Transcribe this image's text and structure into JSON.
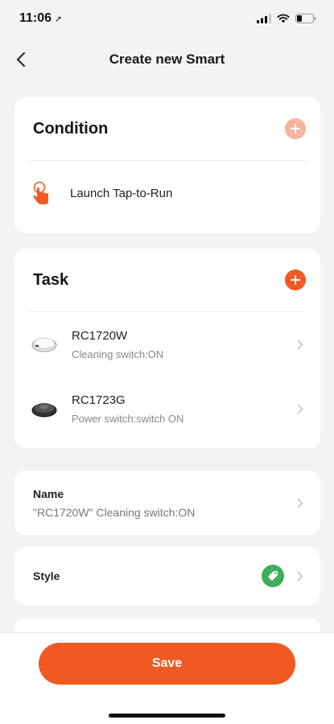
{
  "status_bar": {
    "time": "11:06"
  },
  "nav": {
    "title": "Create new Smart"
  },
  "condition": {
    "title": "Condition",
    "item_label": "Launch Tap-to-Run"
  },
  "task": {
    "title": "Task",
    "items": [
      {
        "name": "RC1720W",
        "detail": "Cleaning switch:ON"
      },
      {
        "name": "RC1723G",
        "detail": "Power switch:switch ON"
      }
    ]
  },
  "name_section": {
    "label": "Name",
    "value": "\"RC1720W\" Cleaning switch:ON"
  },
  "style_section": {
    "label": "Style"
  },
  "save_label": "Save",
  "colors": {
    "accent": "#f05a22",
    "accent_light": "#f6b49e",
    "style_green": "#3fae5a"
  }
}
